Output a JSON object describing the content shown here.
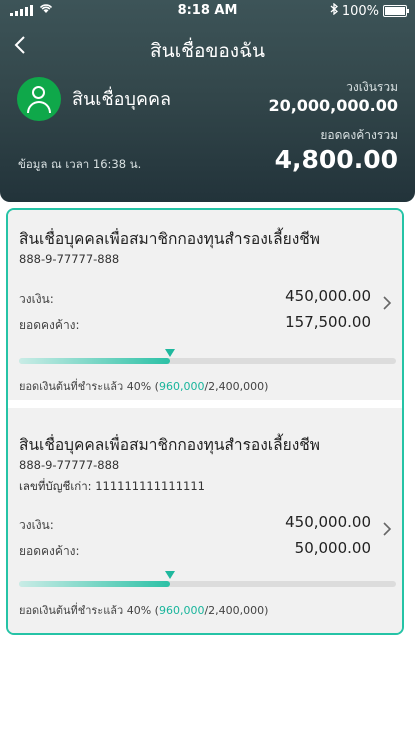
{
  "status_bar": {
    "time": "8:18 AM",
    "battery": "100%"
  },
  "header": {
    "back_icon": "chevron-left-icon",
    "title": "สินเชื่อของฉัน",
    "product_type": "สินเชื่อบุคคล",
    "limit_label": "วงเงินรวม",
    "limit_value": "20,000,000.00",
    "balance_label": "ยอดคงค้างรวม",
    "balance_value": "4,800.00",
    "as_of": "ข้อมูล ณ เวลา 16:38 น."
  },
  "colors": {
    "accent": "#25c3a6",
    "header_bg": "#33474b",
    "avatar": "#0fa84a"
  },
  "loans": [
    {
      "name": "สินเชื่อบุคคลเพื่อสมาชิกกองทุนสำรองเลี้ยงชีพ",
      "account": "888-9-77777-888",
      "limit_label": "วงเงิน:",
      "limit_value": "450,000.00",
      "balance_label": "ยอดคงค้าง:",
      "balance_value": "157,500.00",
      "progress_fraction": 0.4,
      "paid_prefix": "ยอดเงินต้นที่ชำระแล้ว 40% (",
      "paid_amount": "960,000",
      "paid_suffix": "/2,400,000)"
    },
    {
      "name": "สินเชื่อบุคคลเพื่อสมาชิกกองทุนสำรองเลี้ยงชีพ",
      "account": "888-9-77777-888",
      "old_account": "เลขที่บัญชีเก่า: 111111111111111",
      "limit_label": "วงเงิน:",
      "limit_value": "450,000.00",
      "balance_label": "ยอดคงค้าง:",
      "balance_value": "50,000.00",
      "progress_fraction": 0.4,
      "paid_prefix": "ยอดเงินต้นที่ชำระแล้ว 40% (",
      "paid_amount": "960,000",
      "paid_suffix": "/2,400,000)"
    }
  ]
}
